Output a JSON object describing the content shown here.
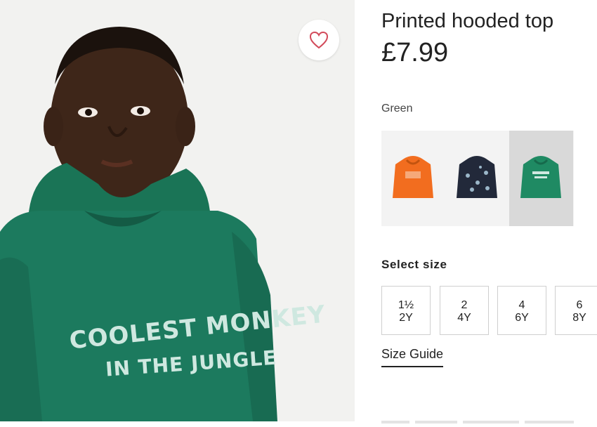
{
  "product": {
    "title": "Printed hooded top",
    "price": "£7.99",
    "color_label": "Green",
    "hoodie_print_line1": "COOLEST MONKEY",
    "hoodie_print_line2": "IN THE JUNGLE"
  },
  "favorite_icon": "heart-icon",
  "swatches": [
    {
      "name": "orange",
      "color": "#f26d1f"
    },
    {
      "name": "navy-print",
      "color": "#22293a"
    },
    {
      "name": "green",
      "color": "#1f8a63",
      "selected": true
    }
  ],
  "size_section": {
    "label": "Select size",
    "sizes": [
      {
        "line1": "1½",
        "line2": "2Y"
      },
      {
        "line1": "2",
        "line2": "4Y"
      },
      {
        "line1": "4",
        "line2": "6Y"
      },
      {
        "line1": "6",
        "line2": "8Y"
      }
    ],
    "guide_label": "Size Guide"
  },
  "colors": {
    "hoodie": "#1c7a5e",
    "print": "#cfe8e0",
    "accent": "#d24a5a"
  }
}
